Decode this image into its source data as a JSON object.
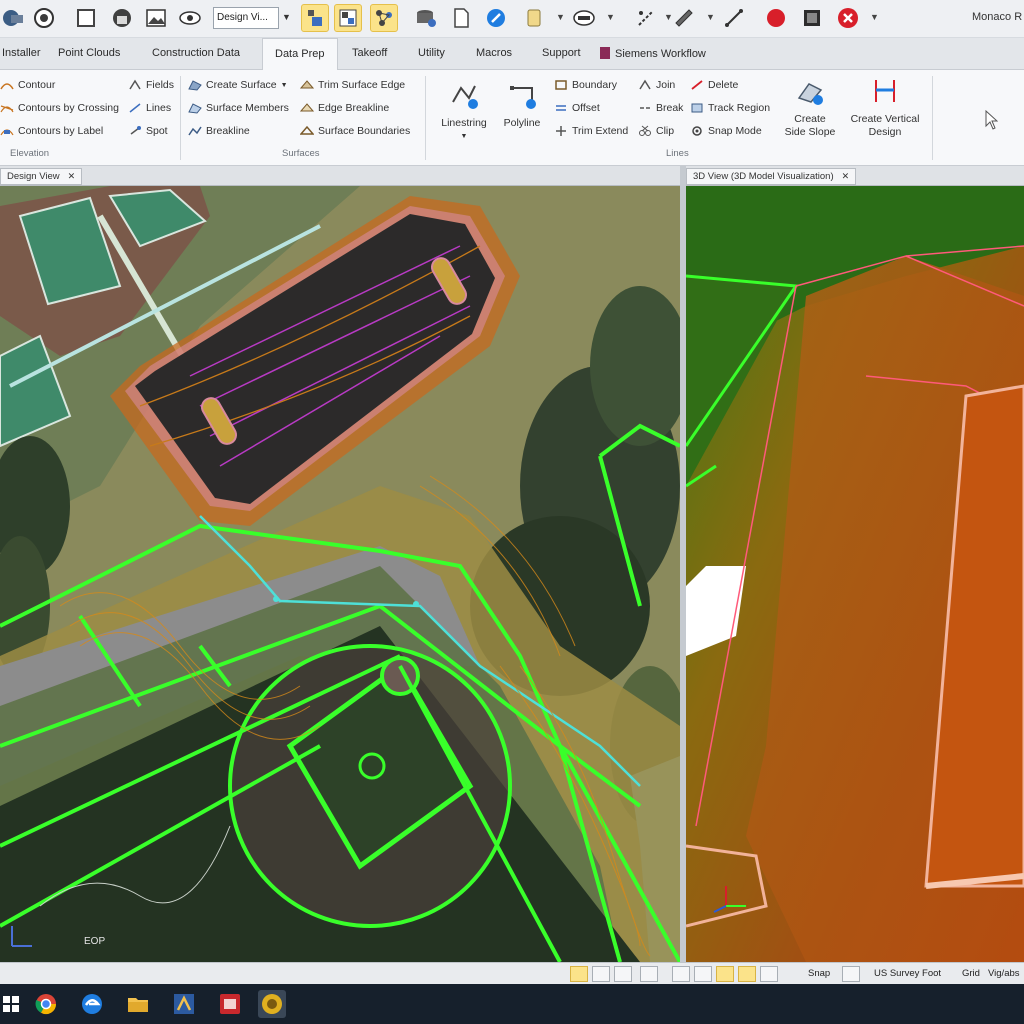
{
  "quick_access": {
    "design_select_value": "Design Vi...",
    "user_label": "Monaco R",
    "icons": [
      "terrain-icon",
      "globe-icon",
      "frame-icon",
      "home-icon",
      "image-icon",
      "eye-icon",
      "layers-icon",
      "grid-icon",
      "network-icon",
      "database-icon",
      "document-icon",
      "compass-icon",
      "note-icon",
      "print-icon",
      "ruler-icon",
      "measure-icon",
      "axis-icon",
      "record-icon",
      "export-icon",
      "close-circle-icon"
    ]
  },
  "tabs": [
    {
      "label": "Installer"
    },
    {
      "label": "Point Clouds"
    },
    {
      "label": "Construction Data"
    },
    {
      "label": "Data Prep"
    },
    {
      "label": "Takeoff"
    },
    {
      "label": "Utility"
    },
    {
      "label": "Macros"
    },
    {
      "label": "Support"
    },
    {
      "label": "Siemens Workflow"
    }
  ],
  "active_tab": "Data Prep",
  "ribbon": {
    "contour": {
      "group_label": "Elevation",
      "items": [
        {
          "label": "Contour"
        },
        {
          "label": "Contours by Crossing"
        },
        {
          "label": "Contours by Label"
        },
        {
          "label": "Fields"
        },
        {
          "label": "Lines"
        },
        {
          "label": "Spot"
        }
      ]
    },
    "surfaces": {
      "group_label": "Surfaces",
      "items": [
        {
          "label": "Create Surface"
        },
        {
          "label": "Surface Members"
        },
        {
          "label": "Breakline"
        },
        {
          "label": "Trim Surface Edge"
        },
        {
          "label": "Edge Breakline"
        },
        {
          "label": "Surface Boundaries"
        }
      ]
    },
    "lines": {
      "group_label": "Lines",
      "linestring": "Linestring",
      "polyline": "Polyline",
      "items": [
        {
          "label": "Boundary"
        },
        {
          "label": "Offset"
        },
        {
          "label": "Trim Extend"
        },
        {
          "label": "Join"
        },
        {
          "label": "Break"
        },
        {
          "label": "Clip"
        },
        {
          "label": "Delete"
        },
        {
          "label": "Track Region"
        },
        {
          "label": "Snap Mode"
        }
      ]
    },
    "side_slope": {
      "line1": "Create",
      "line2": "Side Slope"
    },
    "vertical_design": {
      "line1": "Create Vertical",
      "line2": "Design"
    }
  },
  "viewports": {
    "left_tab": "Design View",
    "right_tab": "3D View (3D Model Visualization)",
    "compass_label": "EOP"
  },
  "status_bar": {
    "snap_label": "Snap",
    "coord_system": "US Survey Foot",
    "grid_label": "Grid",
    "right_label": "Vig/abs"
  },
  "taskbar": {
    "icons": [
      "windows-start-icon",
      "chrome-icon",
      "edge-icon",
      "file-explorer-icon",
      "ad-icon",
      "app-red-icon",
      "app-gold-icon"
    ]
  },
  "colors": {
    "ribbon_bg": "#f7f8fa",
    "accent_yellow": "#fbe38a",
    "linework_green": "#39ff2a",
    "surface_orange": "#c66a1f",
    "taskbar": "#16202c"
  }
}
